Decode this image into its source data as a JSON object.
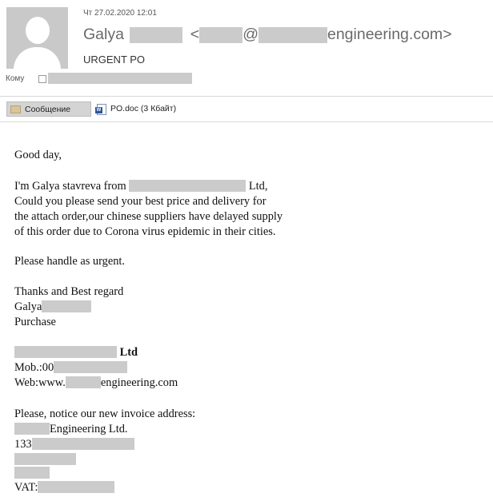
{
  "header": {
    "date": "Чт 27.02.2020 12:01",
    "sender_name": "Galya",
    "sender_email_prefix": "<",
    "sender_email_mid": "@",
    "sender_email_domain": "engineering.com>",
    "subject": "URGENT PO",
    "to_label": "Кому"
  },
  "tabs": {
    "message_label": "Сообщение",
    "attachment_label": "PO.doc (3 Кбайт)"
  },
  "body": {
    "greeting": "Good day,",
    "intro_pre": "I'm Galya stavreva from",
    "intro_post": "Ltd,",
    "line2": "Could you please send your best price and delivery for",
    "line3": "the attach order,our chinese suppliers have delayed supply",
    "line4": "of this order due to Corona virus epidemic in their cities.",
    "urgent": "Please handle as urgent.",
    "thanks": "Thanks and Best regard",
    "sign_name": "Galya",
    "sign_role": "Purchase",
    "company_suffix": "Ltd",
    "mob_prefix": "Mob.:00",
    "web_prefix": "Web:www.",
    "web_suffix": "engineering.com",
    "notice": "Please, notice our new invoice address:",
    "addr_company": "Engineering Ltd.",
    "addr_num": "133",
    "vat_prefix": "VAT:"
  },
  "colors": {
    "redaction": "#cbcbcb",
    "tab_bg": "#d4d4d4"
  }
}
